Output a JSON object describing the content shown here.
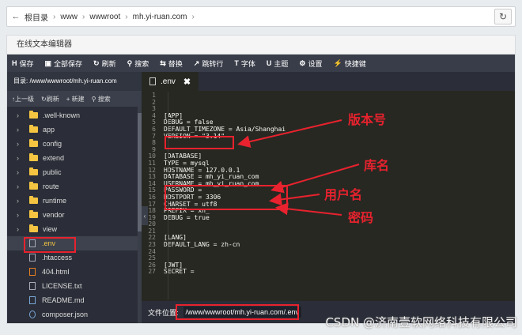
{
  "breadcrumb": {
    "back_icon": "back-arrow-icon",
    "items": [
      "根目录",
      "www",
      "wwwroot",
      "mh.yi-ruan.com"
    ]
  },
  "panel": {
    "title": "在线文本编辑器"
  },
  "toolbar": {
    "items": [
      {
        "icon": "H",
        "label": "保存"
      },
      {
        "icon": "▣",
        "label": "全部保存"
      },
      {
        "icon": "↻",
        "label": "刷新"
      },
      {
        "icon": "⚲",
        "label": "搜索"
      },
      {
        "icon": "⇆",
        "label": "替换"
      },
      {
        "icon": "↗",
        "label": "跳转行"
      },
      {
        "icon": "T",
        "label": "字体"
      },
      {
        "icon": "U",
        "label": "主题"
      },
      {
        "icon": "⚙",
        "label": "设置"
      },
      {
        "icon": "⚡",
        "label": "快捷键"
      }
    ]
  },
  "sidebar": {
    "path": "目录: /www/wwwroot/mh.yi-ruan.com",
    "actions": [
      "↑上一级",
      "↻刷新",
      "+ 新建",
      "⚲ 搜索"
    ],
    "tree": [
      {
        "type": "folder",
        "label": ".well-known"
      },
      {
        "type": "folder",
        "label": "app"
      },
      {
        "type": "folder",
        "label": "config"
      },
      {
        "type": "folder",
        "label": "extend"
      },
      {
        "type": "folder",
        "label": "public"
      },
      {
        "type": "folder",
        "label": "route"
      },
      {
        "type": "folder",
        "label": "runtime"
      },
      {
        "type": "folder",
        "label": "vendor"
      },
      {
        "type": "folder",
        "label": "view"
      },
      {
        "type": "file",
        "label": ".env"
      },
      {
        "type": "file",
        "label": ".htaccess"
      },
      {
        "type": "file",
        "label": "404.html"
      },
      {
        "type": "file",
        "label": "LICENSE.txt"
      },
      {
        "type": "file",
        "label": "README.md"
      },
      {
        "type": "file",
        "label": "composer.json"
      }
    ]
  },
  "editor": {
    "tab_label": ".env",
    "lines": [
      "",
      "",
      "",
      "[APP]",
      "DEBUG = false",
      "DEFAULT_TIMEZONE = Asia/Shanghai",
      "VERSION = \"3.14\"",
      "",
      "",
      "[DATABASE]",
      "TYPE = mysql",
      "HOSTNAME = 127.0.0.1",
      "DATABASE = mh_yi_ruan_com",
      "USERNAME = mh_yi_ruan_com",
      "PASSWORD = ",
      "HOSTPORT = 3306",
      "CHARSET = utf8",
      "PREFIX = xn_",
      "DEBUG = true",
      "",
      "",
      "[LANG]",
      "DEFAULT_LANG = zh-cn",
      "",
      "",
      "[JWT]",
      "SECRET = "
    ],
    "file_location_label": "文件位置:",
    "file_location_value": "/www/wwwroot/mh.yi-ruan.com/.env"
  },
  "annotations": {
    "version": "版本号",
    "database": "库名",
    "username": "用户名",
    "password": "密码"
  },
  "watermark": "CSDN @济南壹软网络科技有限公司",
  "colors": {
    "annotation": "#e8222e",
    "toolbar_bg": "#393d49",
    "editor_bg": "#272822",
    "folder": "#f5c542"
  }
}
